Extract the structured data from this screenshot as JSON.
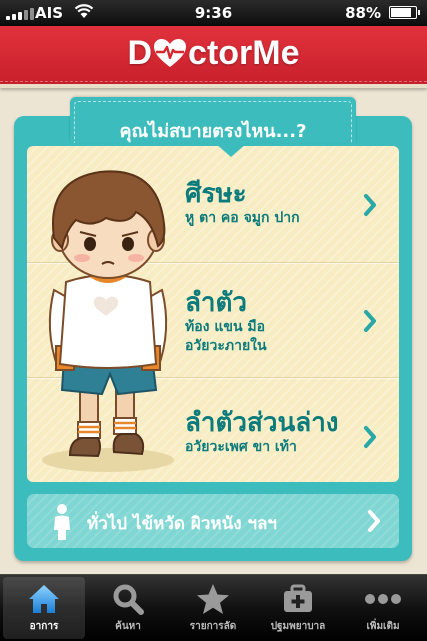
{
  "status_bar": {
    "carrier": "AIS",
    "time": "9:36",
    "battery": "88%",
    "battery_level": 0.88
  },
  "header": {
    "logo_pre": "D",
    "logo_post": "ctorMe"
  },
  "question": "คุณไม่สบายตรงไหน...?",
  "body_parts": [
    {
      "title": "ศีรษะ",
      "subtitle": "หู ตา คอ จมูก ปาก"
    },
    {
      "title": "ลำตัว",
      "subtitle": "ท้อง แขน มือ\nอวัยวะภายใน"
    },
    {
      "title": "ลำตัวส่วนล่าง",
      "subtitle": "อวัยวะเพศ ขา เท้า"
    }
  ],
  "general": {
    "label": "ทั่วไป  ไข้หวัด  ผิวหนัง  ฯลฯ"
  },
  "tabs": [
    {
      "label": "อาการ",
      "icon": "home-icon",
      "active": true
    },
    {
      "label": "ค้นหา",
      "icon": "search-icon",
      "active": false
    },
    {
      "label": "รายการลัด",
      "icon": "star-icon",
      "active": false
    },
    {
      "label": "ปฐมพยาบาล",
      "icon": "first-aid-icon",
      "active": false
    },
    {
      "label": "เพิ่มเติม",
      "icon": "more-icon",
      "active": false
    }
  ],
  "colors": {
    "brand_red": "#d6262f",
    "teal": "#3cbcbc",
    "teal_text": "#0b7b7b",
    "cream": "#f8ecc3"
  }
}
